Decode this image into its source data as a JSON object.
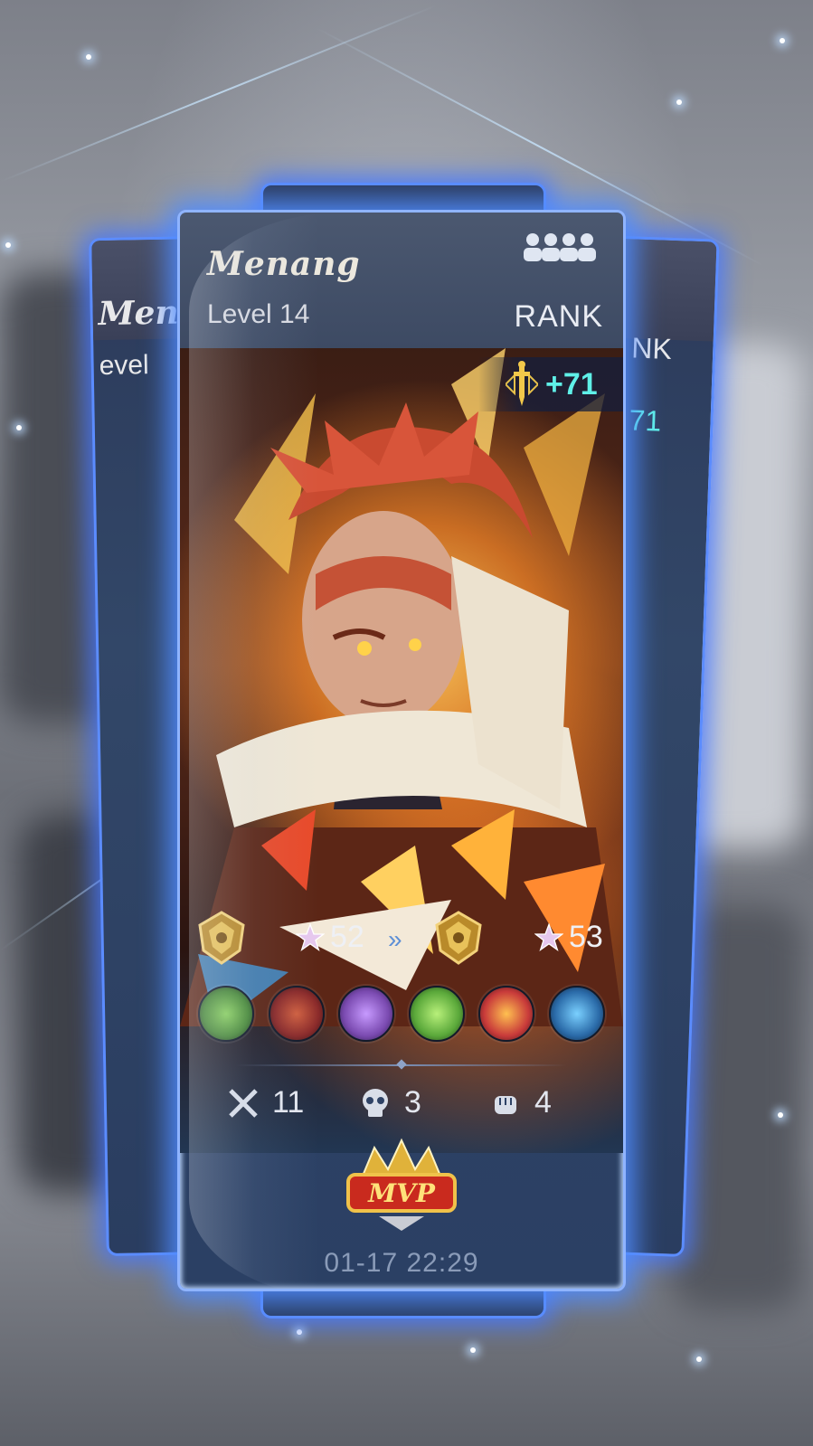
{
  "card": {
    "player_name": "Menang",
    "level": "Level 14",
    "mode": "RANK",
    "points": "+71",
    "rank_before_stars": "52",
    "rank_after_stars": "53",
    "kills": "11",
    "deaths": "3",
    "assists": "4",
    "mvp_label": "MVP",
    "timestamp": "01-17 22:29"
  },
  "back_card_left": {
    "name_fragment": "Mena",
    "level_fragment": "evel"
  },
  "back_card_right": {
    "rank_fragment": "NK",
    "points_fragment": "71"
  },
  "items": [
    {
      "icon": "boots-item-icon",
      "color": "#4a8a3a"
    },
    {
      "icon": "axe-item-icon",
      "color": "#8a2a2a"
    },
    {
      "icon": "gauntlet-item-icon",
      "color": "#7a4ab0"
    },
    {
      "icon": "potion-item-icon",
      "color": "#5aa83a"
    },
    {
      "icon": "armor-item-icon",
      "color": "#c83a3a"
    },
    {
      "icon": "blade-item-icon",
      "color": "#2a6aa8"
    }
  ],
  "colors": {
    "glow": "#5b8cff",
    "points": "#5ff0e8",
    "card_bg": "#2f4366"
  }
}
